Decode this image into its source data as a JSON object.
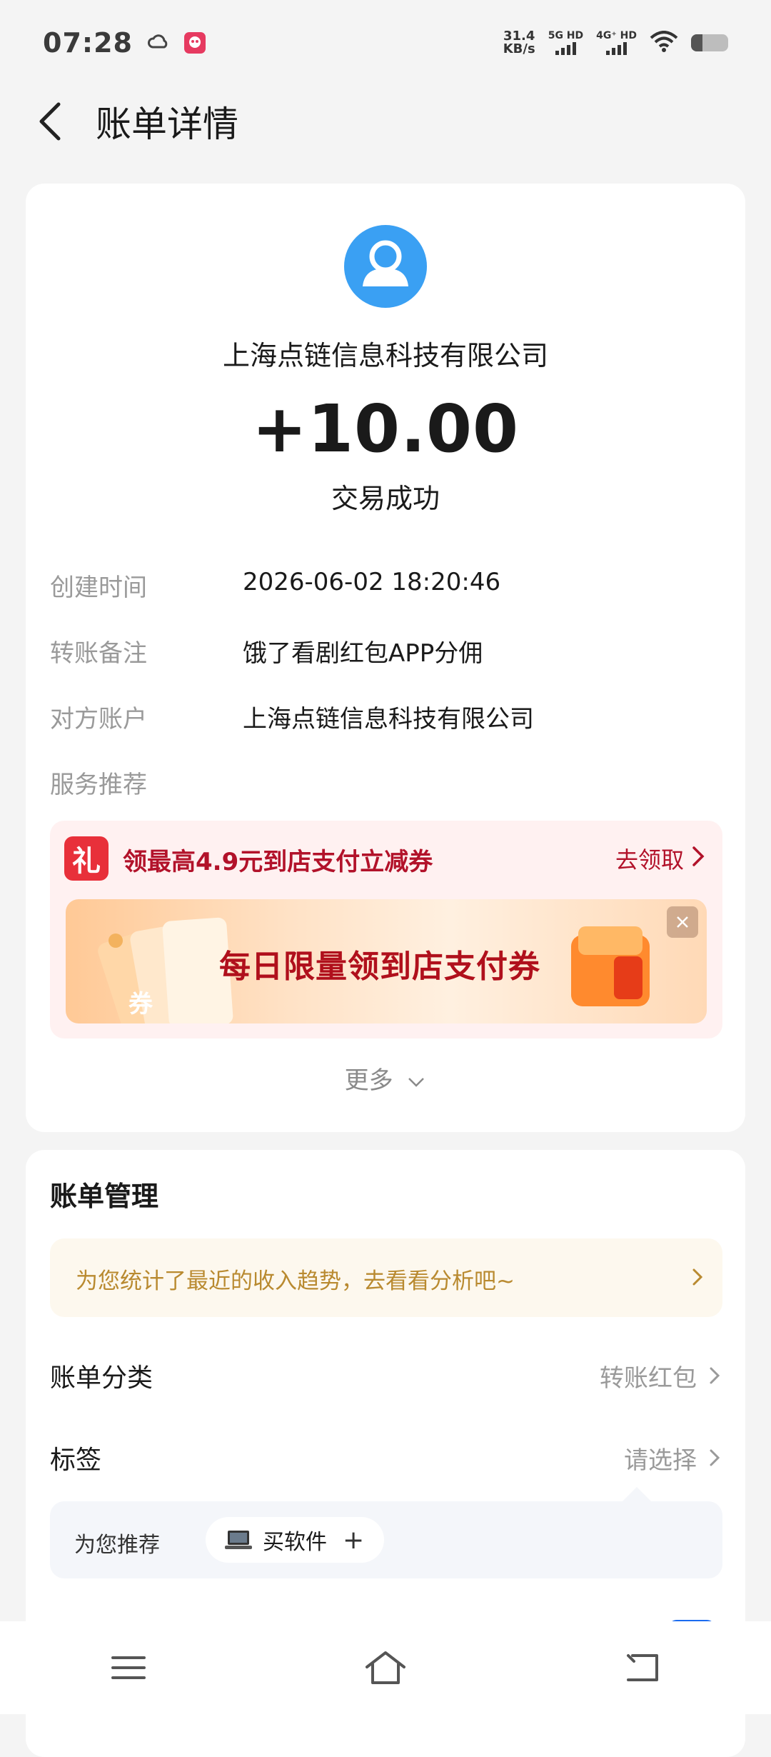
{
  "status_bar": {
    "time": "07:28",
    "net_speed_value": "31.4",
    "net_speed_unit": "KB/s",
    "sim1": "5G HD",
    "sim2": "4G⁺ HD",
    "battery_level": 0.3,
    "icons": [
      "weather-cloud-icon",
      "app-notification-icon",
      "wifi-icon",
      "battery-icon"
    ]
  },
  "header": {
    "title": "账单详情"
  },
  "bill": {
    "payee": "上海点链信息科技有限公司",
    "amount": "+10.00",
    "status": "交易成功",
    "details": [
      {
        "label": "创建时间",
        "value": "2026-06-02 18:20:46"
      },
      {
        "label": "转账备注",
        "value": "饿了看剧红包APP分佣"
      },
      {
        "label": "对方账户",
        "value": "上海点链信息科技有限公司"
      },
      {
        "label": "服务推荐",
        "value": ""
      }
    ]
  },
  "promo": {
    "gift_glyph": "礼",
    "title": "领最高4.9元到店支付立减券",
    "link": "去领取",
    "banner_text": "每日限量领到店支付券",
    "ticket_glyph": "券"
  },
  "more": {
    "label": "更多"
  },
  "management": {
    "title": "账单管理",
    "tip": "为您统计了最近的收入趋势，去看看分析吧~",
    "category_label": "账单分类",
    "category_value": "转账红包",
    "tag_label": "标签",
    "tag_value": "请选择",
    "recommend_label": "为您推荐",
    "recommend_chip": "买软件",
    "recommend_add": "+"
  },
  "colors": {
    "accent_blue": "#3aa0f3",
    "promo_red": "#b2122a",
    "tip_gold": "#b98a30",
    "page_bg": "#f4f4f4"
  }
}
